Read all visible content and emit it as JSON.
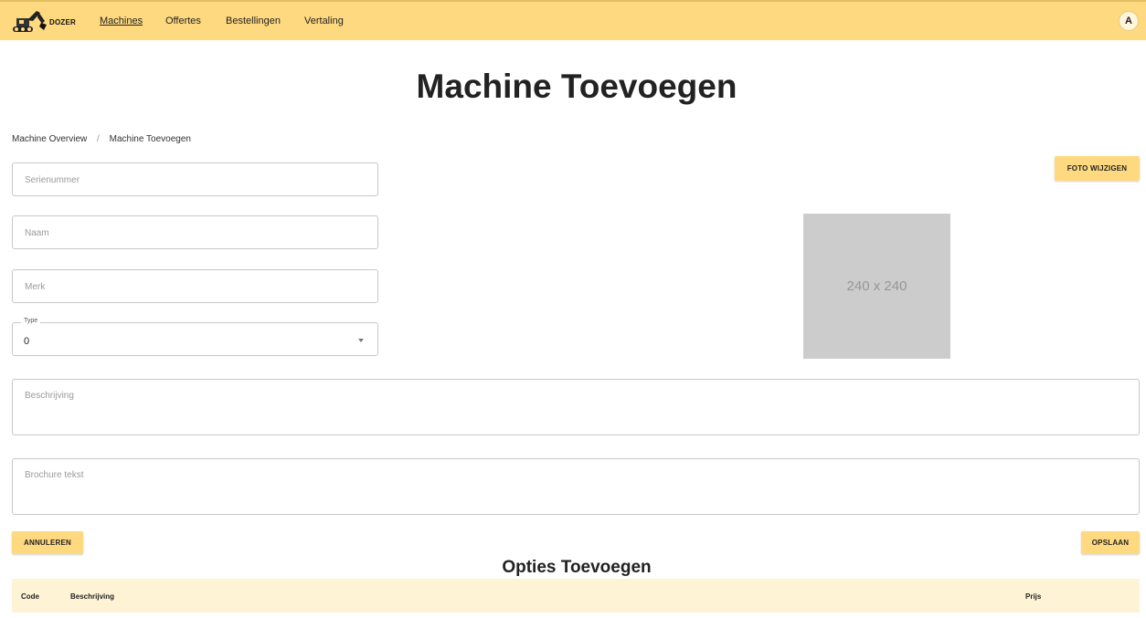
{
  "header": {
    "logo_text": "DOZER",
    "nav": [
      "Machines",
      "Offertes",
      "Bestellingen",
      "Vertaling"
    ],
    "active_nav": "Machines",
    "avatar_initial": "A",
    "accent_color": "#ffd97f"
  },
  "page": {
    "title": "Machine Toevoegen"
  },
  "breadcrumb": {
    "items": [
      "Machine Overview",
      "Machine Toevoegen"
    ],
    "separator": "/"
  },
  "form": {
    "serienummer": {
      "placeholder": "Serienummer",
      "value": ""
    },
    "naam": {
      "placeholder": "Naam",
      "value": ""
    },
    "merk": {
      "placeholder": "Merk",
      "value": ""
    },
    "type": {
      "label": "Type",
      "value": "0"
    },
    "beschrijving": {
      "placeholder": "Beschrijving",
      "value": ""
    },
    "brochure": {
      "placeholder": "Brochure tekst",
      "value": ""
    }
  },
  "photo": {
    "button_label": "FOTO WIJZIGEN",
    "placeholder_text": "240 x 240"
  },
  "actions": {
    "cancel_label": "ANNULEREN",
    "save_label": "OPSLAAN"
  },
  "options": {
    "title": "Opties Toevoegen",
    "columns": [
      "Code",
      "Beschrijving",
      "Prijs"
    ]
  }
}
